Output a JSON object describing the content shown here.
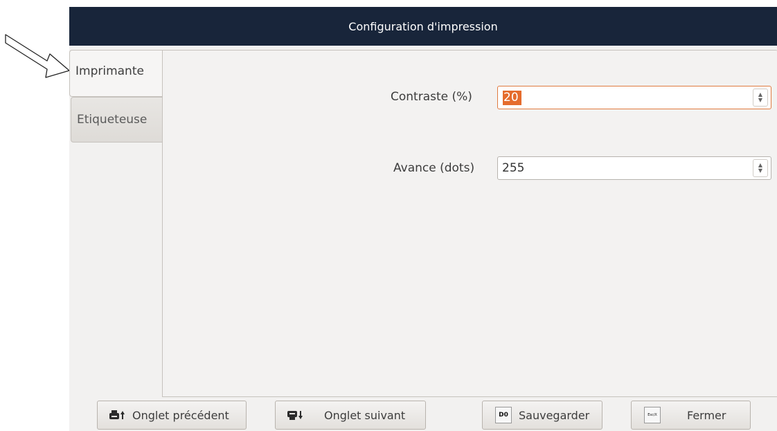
{
  "window": {
    "title": "Configuration d'impression"
  },
  "tabs": [
    {
      "label": "Imprimante",
      "active": true
    },
    {
      "label": "Etiqueteuse",
      "active": false
    }
  ],
  "fields": {
    "contrast": {
      "label": "Contraste (%)",
      "value": "20"
    },
    "advance": {
      "label": "Avance (dots)",
      "value": "255"
    }
  },
  "buttons": {
    "prev_tab": {
      "label": "Onglet précédent",
      "icon": "printer-up-icon"
    },
    "next_tab": {
      "label": "Onglet suivant",
      "icon": "printer-down-icon"
    },
    "save": {
      "label": "Sauvegarder",
      "icon": "d0-key-icon",
      "icon_text": "D0"
    },
    "close": {
      "label": "Fermer",
      "icon": "esc-key-icon",
      "icon_text": "Esc/X"
    }
  },
  "colors": {
    "titlebar_bg": "#18253a",
    "focus_accent": "#e56c2d"
  }
}
